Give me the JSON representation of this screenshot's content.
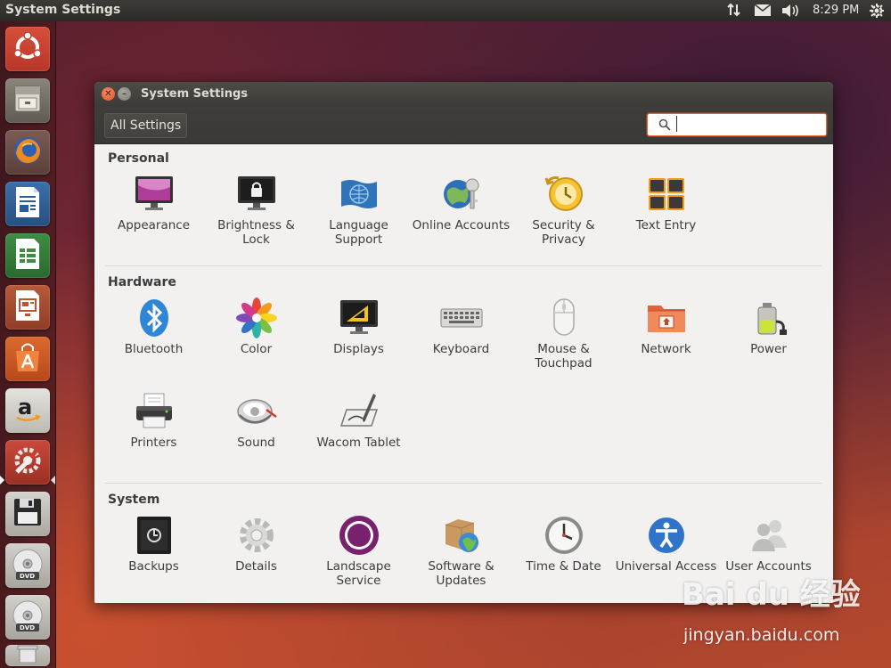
{
  "top_panel": {
    "title": "System Settings",
    "clock": "8:29 PM",
    "indicators": [
      "network-updown-icon",
      "mail-icon",
      "volume-icon",
      "gear-icon"
    ]
  },
  "launcher": {
    "items": [
      {
        "name": "ubuntu-dash",
        "icon": "ubuntu-logo-icon"
      },
      {
        "name": "files",
        "icon": "file-cabinet-icon"
      },
      {
        "name": "firefox",
        "icon": "firefox-icon"
      },
      {
        "name": "libreoffice-writer",
        "icon": "writer-icon"
      },
      {
        "name": "libreoffice-calc",
        "icon": "calc-icon"
      },
      {
        "name": "libreoffice-impress",
        "icon": "impress-icon"
      },
      {
        "name": "software-center",
        "icon": "shopping-bag-icon"
      },
      {
        "name": "amazon",
        "icon": "amazon-icon"
      },
      {
        "name": "system-settings",
        "icon": "settings-wrench-icon",
        "active": true
      },
      {
        "name": "floppy",
        "icon": "floppy-icon"
      },
      {
        "name": "dvd-1",
        "icon": "dvd-icon",
        "label": "DVD"
      },
      {
        "name": "dvd-2",
        "icon": "dvd-icon",
        "label": "DVD"
      },
      {
        "name": "trash",
        "icon": "trash-icon"
      }
    ]
  },
  "window": {
    "title": "System Settings",
    "toolbar": {
      "all_settings_label": "All Settings",
      "search_placeholder": ""
    },
    "sections": {
      "personal": {
        "header": "Personal",
        "items": [
          {
            "label": "Appearance",
            "icon": "appearance-icon"
          },
          {
            "label": "Brightness & Lock",
            "icon": "brightness-lock-icon"
          },
          {
            "label": "Language Support",
            "icon": "language-support-icon"
          },
          {
            "label": "Online Accounts",
            "icon": "online-accounts-icon"
          },
          {
            "label": "Security & Privacy",
            "icon": "security-privacy-icon"
          },
          {
            "label": "Text Entry",
            "icon": "text-entry-icon"
          }
        ]
      },
      "hardware": {
        "header": "Hardware",
        "items": [
          {
            "label": "Bluetooth",
            "icon": "bluetooth-icon"
          },
          {
            "label": "Color",
            "icon": "color-icon"
          },
          {
            "label": "Displays",
            "icon": "displays-icon"
          },
          {
            "label": "Keyboard",
            "icon": "keyboard-icon"
          },
          {
            "label": "Mouse & Touchpad",
            "icon": "mouse-icon"
          },
          {
            "label": "Network",
            "icon": "network-icon"
          },
          {
            "label": "Power",
            "icon": "power-icon"
          },
          {
            "label": "Printers",
            "icon": "printer-icon"
          },
          {
            "label": "Sound",
            "icon": "sound-icon"
          },
          {
            "label": "Wacom Tablet",
            "icon": "wacom-tablet-icon"
          }
        ]
      },
      "system": {
        "header": "System",
        "items": [
          {
            "label": "Backups",
            "icon": "backups-icon"
          },
          {
            "label": "Details",
            "icon": "details-gear-icon"
          },
          {
            "label": "Landscape Service",
            "icon": "landscape-icon"
          },
          {
            "label": "Software & Updates",
            "icon": "software-updates-icon"
          },
          {
            "label": "Time & Date",
            "icon": "clock-icon"
          },
          {
            "label": "Universal Access",
            "icon": "universal-access-icon"
          },
          {
            "label": "User Accounts",
            "icon": "user-accounts-icon"
          }
        ]
      }
    }
  },
  "watermark": {
    "brand": "Bai du 经验",
    "url": "jingyan.baidu.com"
  },
  "colors": {
    "accent_orange": "#e8622e",
    "panel_dark": "#3c3b37",
    "window_bg": "#f2f1f0"
  }
}
